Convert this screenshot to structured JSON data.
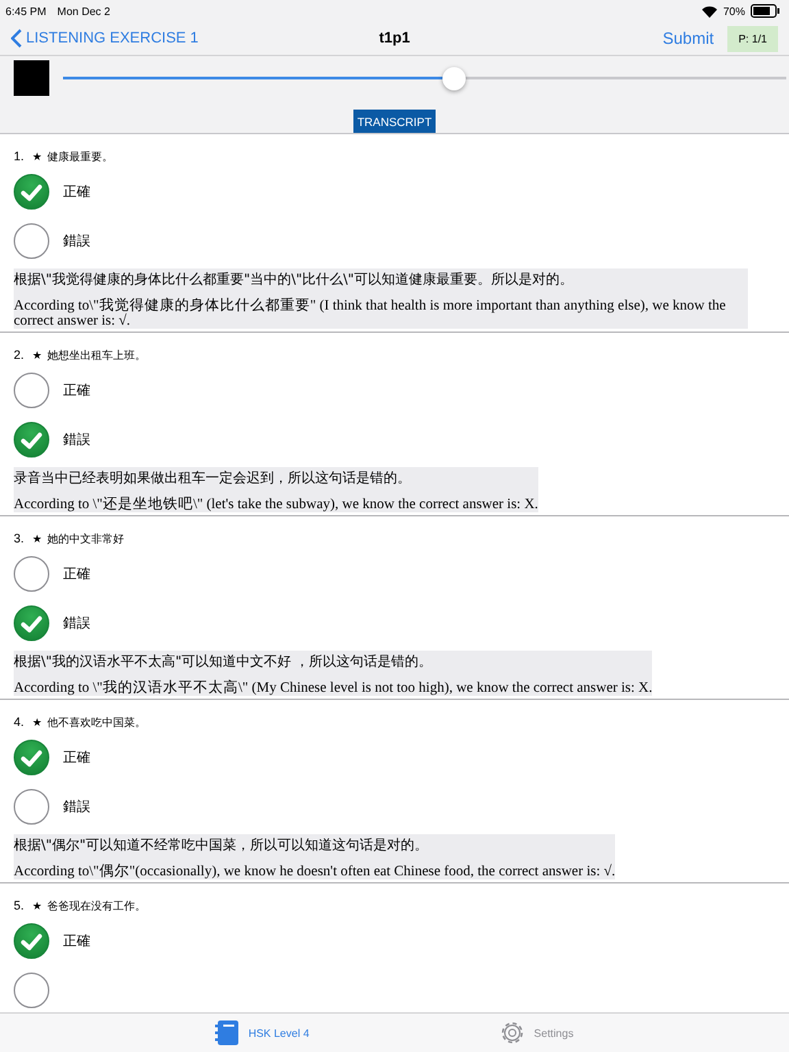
{
  "status_bar": {
    "time": "6:45 PM",
    "date": "Mon Dec 2",
    "battery": "70%"
  },
  "nav": {
    "back": "LISTENING EXERCISE 1",
    "title": "t1p1",
    "submit": "Submit",
    "page": "P: 1/1"
  },
  "player": {
    "level": 0.54,
    "transcript": "TRANSCRIPT"
  },
  "questions": [
    {
      "number": "1.",
      "star": "★",
      "text": "健康最重要。",
      "options": [
        {
          "label": "正確",
          "selected": true
        },
        {
          "label": "錯誤",
          "selected": false
        }
      ],
      "explanation_zh": "根据\\\"我觉得健康的身体比什么都重要\"当中的\\\"比什么\\\"可以知道健康最重要。所以是对的。",
      "explanation_en": "According to\\\"我觉得健康的身体比什么都重要\" (I think that health is more important than anything else), we know the correct answer is: √."
    },
    {
      "number": "2.",
      "star": "★",
      "text": "她想坐出租车上班。",
      "options": [
        {
          "label": "正確",
          "selected": false
        },
        {
          "label": "錯誤",
          "selected": true
        }
      ],
      "explanation_zh": "录音当中已经表明如果做出租车一定会迟到，所以这句话是错的。",
      "explanation_en": "According to \\\"还是坐地铁吧\\\" (let's take the subway), we know the correct answer is: X."
    },
    {
      "number": "3.",
      "star": "★",
      "text": "她的中文非常好",
      "options": [
        {
          "label": "正確",
          "selected": false
        },
        {
          "label": "錯誤",
          "selected": true
        }
      ],
      "explanation_zh": "根据\\\"我的汉语水平不太高\"可以知道中文不好 ，所以这句话是错的。",
      "explanation_en": "According to \\\"我的汉语水平不太高\\\" (My Chinese level is not too high), we know the correct answer is: X."
    },
    {
      "number": "4.",
      "star": "★",
      "text": "他不喜欢吃中国菜。",
      "options": [
        {
          "label": "正確",
          "selected": true
        },
        {
          "label": "錯誤",
          "selected": false
        }
      ],
      "explanation_zh": "根据\\\"偶尔\"可以知道不经常吃中国菜，所以可以知道这句话是对的。",
      "explanation_en": "According to\\\"偶尔\"(occasionally), we know he doesn't often eat Chinese food, the correct answer is: √."
    },
    {
      "number": "5.",
      "star": "★",
      "text": "爸爸现在没有工作。",
      "options": [
        {
          "label": "正確",
          "selected": true
        },
        {
          "selected": false
        }
      ]
    }
  ],
  "tab_bar": [
    {
      "kind": "notebook",
      "label": "HSK Level 4",
      "selected": true
    },
    {
      "kind": "gear",
      "label": "Settings",
      "selected": false
    }
  ]
}
